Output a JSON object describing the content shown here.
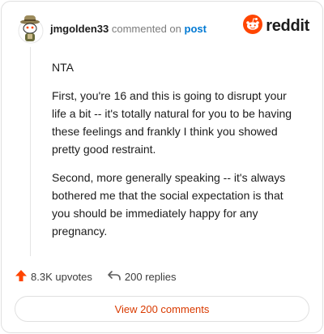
{
  "header": {
    "username": "jmgolden33",
    "commented_text": "commented on",
    "post_link": "post",
    "brand": "reddit"
  },
  "comment": {
    "paragraphs": [
      "NTA",
      "First, you're 16 and this is going to disrupt your life a bit -- it's totally natural for you to be having these feelings and frankly I think you showed pretty good restraint.",
      "Second, more generally speaking -- it's always bothered me that the social expectation is that you should be immediately happy for any pregnancy."
    ]
  },
  "actions": {
    "upvotes": "8.3K upvotes",
    "replies": "200 replies"
  },
  "view_button": "View 200 comments",
  "colors": {
    "accent": "#ff4500",
    "link": "#0079d3",
    "view_text": "#d93a00"
  },
  "icons": [
    "avatar",
    "reddit-logo-icon",
    "upvote-arrow-icon",
    "reply-arrow-icon"
  ]
}
